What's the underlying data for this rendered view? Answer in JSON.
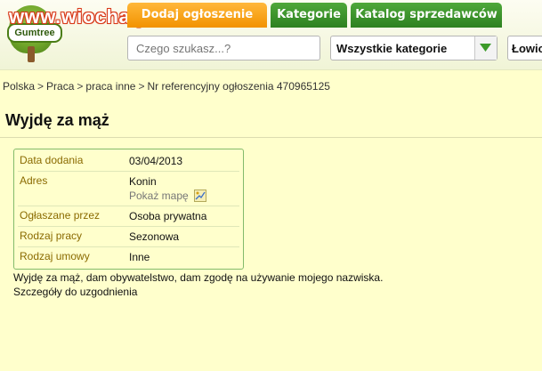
{
  "watermark": "www.wiocha.pl",
  "logo": {
    "brand": "Gumtree"
  },
  "nav": {
    "tabs": [
      {
        "label": "Dodaj ogłoszenie"
      },
      {
        "label": "Kategorie"
      },
      {
        "label": "Katalog sprzedawców"
      }
    ]
  },
  "search": {
    "placeholder": "Czego szukasz...?",
    "category": "Wszystkie kategorie",
    "location": "Łowicz"
  },
  "breadcrumb": {
    "items": [
      "Polska",
      "Praca",
      "praca inne",
      "Nr referencyjny ogłoszenia 470965125"
    ],
    "separator": ">"
  },
  "listing": {
    "title": "Wyjdę za mąż",
    "details": [
      {
        "label": "Data dodania",
        "value": "03/04/2013"
      },
      {
        "label": "Adres",
        "value": "Konin",
        "extra": "Pokaż mapę"
      },
      {
        "label": "Ogłaszane przez",
        "value": "Osoba prywatna"
      },
      {
        "label": "Rodzaj pracy",
        "value": "Sezonowa"
      },
      {
        "label": "Rodzaj umowy",
        "value": "Inne"
      }
    ],
    "description": [
      "Wyjdę za mąż, dam obywatelstwo, dam zgodę na używanie mojego nazwiska.",
      "Szczegóły do uzgodnienia"
    ]
  },
  "colors": {
    "background": "#ffffcc",
    "tab_orange": "#f29200",
    "tab_green": "#2d8120",
    "detail_border": "#84bb6a",
    "detail_label": "#8a6a00"
  }
}
